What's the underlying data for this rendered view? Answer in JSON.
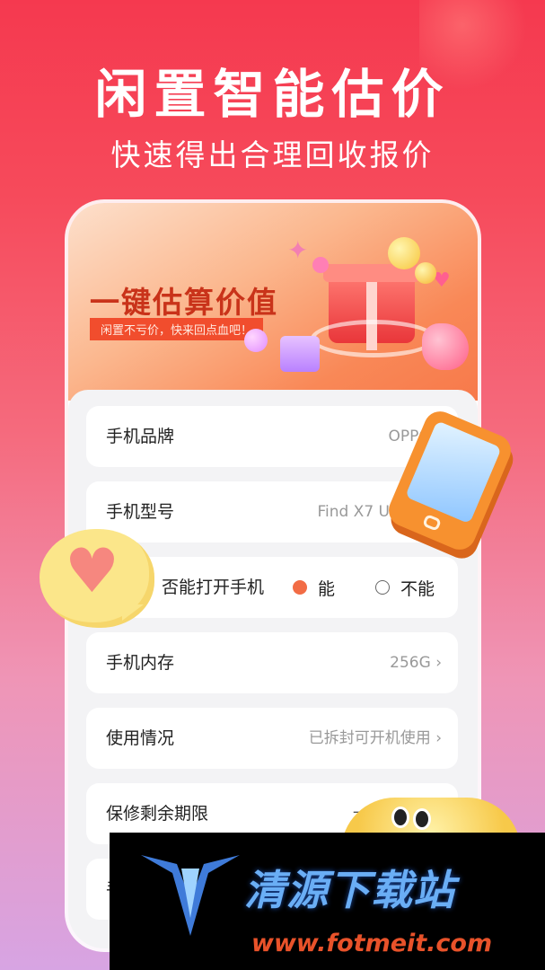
{
  "hero": {
    "title": "闲置智能估价",
    "subtitle": "快速得出合理回收报价"
  },
  "banner": {
    "title": "一键估算价值",
    "tagline": "闲置不亏价，快来回点血吧！"
  },
  "form": {
    "brand": {
      "label": "手机品牌",
      "value": "OPPO"
    },
    "model": {
      "label": "手机型号",
      "value": "Find X7 U"
    },
    "power_on": {
      "label": "否能打开手机",
      "options": [
        {
          "label": "能",
          "selected": true
        },
        {
          "label": "不能",
          "selected": false
        }
      ]
    },
    "storage": {
      "label": "手机内存",
      "value": "256G"
    },
    "usage": {
      "label": "使用情况",
      "value": "已拆封可开机使用"
    },
    "warranty": {
      "label": "保修剩余期限",
      "value": "一"
    },
    "partial_label": "手"
  },
  "icons": {
    "chevron": "chevron-right-icon",
    "phone_illustration": "smartphone-icon",
    "heart_bubble": "heart-chat-bubble-icon",
    "gift": "gift-box-icon"
  },
  "watermark": {
    "name": "清源下载站",
    "url": "www.fotmeit.com"
  },
  "colors": {
    "accent": "#f26c45",
    "bg_top": "#f5394f",
    "bg_bottom": "#d7a4e3"
  }
}
